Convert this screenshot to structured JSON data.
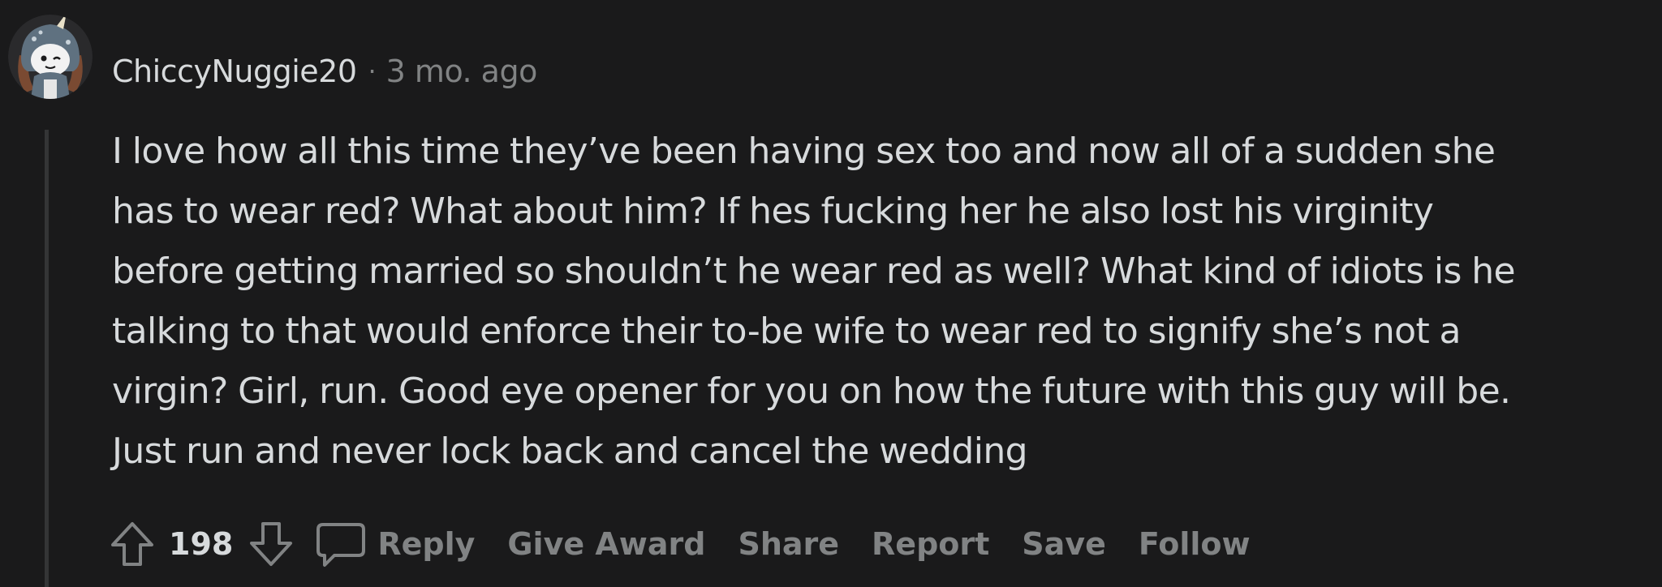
{
  "comment": {
    "author": "ChiccyNuggie20",
    "separator": "·",
    "timestamp": "3 mo. ago",
    "body_lines": [
      "I love how all this time they’ve been having sex too and now all of a sudden she",
      "has to wear red? What about him? If hes fucking her he also lost his virginity",
      "before getting married so shouldn’t he wear red as well? What kind of idiots is he",
      "talking to that would enforce their to-be wife to wear red to signify she’s not a",
      "virgin? Girl, run. Good eye opener for you on how the future with this guy will be.",
      "Just run and never lock back and cancel the wedding"
    ],
    "vote_count": "198"
  },
  "actions": {
    "reply_label": "Reply",
    "give_award_label": "Give Award",
    "share_label": "Share",
    "report_label": "Report",
    "save_label": "Save",
    "follow_label": "Follow"
  },
  "icons": {
    "upvote": "upvote-arrow-icon",
    "downvote": "downvote-arrow-icon",
    "reply": "speech-bubble-icon",
    "avatar": "snoo-avatar-unicorn-hood"
  },
  "colors": {
    "background": "#1a1a1b",
    "text_primary": "#d7dadc",
    "text_muted": "#818384",
    "thread_line": "#343536"
  }
}
